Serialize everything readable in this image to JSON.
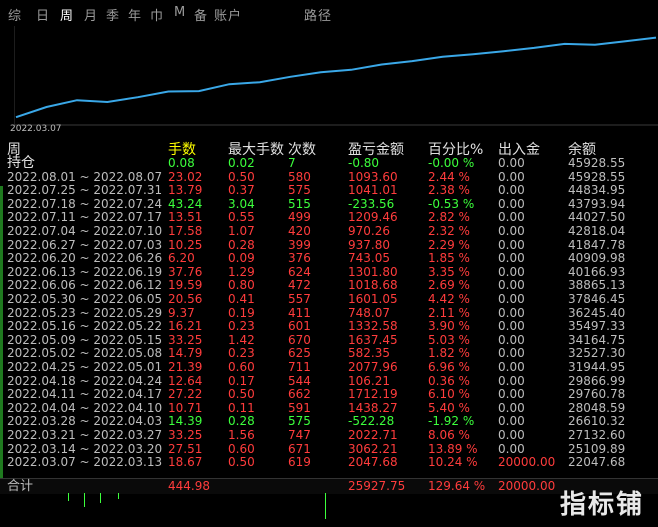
{
  "tabs": [
    {
      "label": "综",
      "active": false
    },
    {
      "label": "日",
      "active": false
    },
    {
      "label": "周",
      "active": true
    },
    {
      "label": "月",
      "active": false
    },
    {
      "label": "季",
      "active": false
    },
    {
      "label": "年",
      "active": false
    },
    {
      "label": "巾",
      "active": false
    },
    {
      "label": "M",
      "active": false
    },
    {
      "label": "备",
      "active": false
    },
    {
      "label": "账户",
      "active": false
    },
    {
      "label": "路径",
      "active": false
    }
  ],
  "chart": {
    "start_date": "2022.03.07",
    "line_color": "#3aa8e8",
    "balances": [
      22047.68,
      25109.89,
      27132.6,
      26610.32,
      28048.59,
      29760.78,
      29866.99,
      31944.95,
      32527.3,
      34164.75,
      35497.33,
      36245.4,
      37846.45,
      38865.13,
      40166.93,
      40909.98,
      41847.78,
      42818.04,
      44027.5,
      43793.94,
      44834.95,
      45928.55
    ]
  },
  "columns": {
    "week": "周",
    "hands": "手数",
    "max": "最大手数",
    "count": "次数",
    "pnl": "盈亏金额",
    "pct": "百分比%",
    "flow": "出入金",
    "balance": "余额"
  },
  "position_row": {
    "label": "持仓",
    "hands": "0.08",
    "max": "0.02",
    "count": "7",
    "pnl": "-0.80",
    "pct": "-0.00 %",
    "flow": "0.00",
    "balance": "45928.55",
    "sign": "green"
  },
  "rows": [
    {
      "week": "2022.08.01 ~ 2022.08.07",
      "hands": "23.02",
      "max": "0.50",
      "count": "580",
      "pnl": "1093.60",
      "pct": "2.44 %",
      "flow": "0.00",
      "balance": "45928.55",
      "sign": "red"
    },
    {
      "week": "2022.07.25 ~ 2022.07.31",
      "hands": "13.79",
      "max": "0.37",
      "count": "575",
      "pnl": "1041.01",
      "pct": "2.38 %",
      "flow": "0.00",
      "balance": "44834.95",
      "sign": "red"
    },
    {
      "week": "2022.07.18 ~ 2022.07.24",
      "hands": "43.24",
      "max": "3.04",
      "count": "515",
      "pnl": "-233.56",
      "pct": "-0.53 %",
      "flow": "0.00",
      "balance": "43793.94",
      "sign": "green"
    },
    {
      "week": "2022.07.11 ~ 2022.07.17",
      "hands": "13.51",
      "max": "0.55",
      "count": "499",
      "pnl": "1209.46",
      "pct": "2.82 %",
      "flow": "0.00",
      "balance": "44027.50",
      "sign": "red"
    },
    {
      "week": "2022.07.04 ~ 2022.07.10",
      "hands": "17.58",
      "max": "1.07",
      "count": "420",
      "pnl": "970.26",
      "pct": "2.32 %",
      "flow": "0.00",
      "balance": "42818.04",
      "sign": "red"
    },
    {
      "week": "2022.06.27 ~ 2022.07.03",
      "hands": "10.25",
      "max": "0.28",
      "count": "399",
      "pnl": "937.80",
      "pct": "2.29 %",
      "flow": "0.00",
      "balance": "41847.78",
      "sign": "red"
    },
    {
      "week": "2022.06.20 ~ 2022.06.26",
      "hands": "6.20",
      "max": "0.09",
      "count": "376",
      "pnl": "743.05",
      "pct": "1.85 %",
      "flow": "0.00",
      "balance": "40909.98",
      "sign": "red"
    },
    {
      "week": "2022.06.13 ~ 2022.06.19",
      "hands": "37.76",
      "max": "1.29",
      "count": "624",
      "pnl": "1301.80",
      "pct": "3.35 %",
      "flow": "0.00",
      "balance": "40166.93",
      "sign": "red"
    },
    {
      "week": "2022.06.06 ~ 2022.06.12",
      "hands": "19.59",
      "max": "0.80",
      "count": "472",
      "pnl": "1018.68",
      "pct": "2.69 %",
      "flow": "0.00",
      "balance": "38865.13",
      "sign": "red"
    },
    {
      "week": "2022.05.30 ~ 2022.06.05",
      "hands": "20.56",
      "max": "0.41",
      "count": "557",
      "pnl": "1601.05",
      "pct": "4.42 %",
      "flow": "0.00",
      "balance": "37846.45",
      "sign": "red"
    },
    {
      "week": "2022.05.23 ~ 2022.05.29",
      "hands": "9.37",
      "max": "0.19",
      "count": "411",
      "pnl": "748.07",
      "pct": "2.11 %",
      "flow": "0.00",
      "balance": "36245.40",
      "sign": "red"
    },
    {
      "week": "2022.05.16 ~ 2022.05.22",
      "hands": "16.21",
      "max": "0.23",
      "count": "601",
      "pnl": "1332.58",
      "pct": "3.90 %",
      "flow": "0.00",
      "balance": "35497.33",
      "sign": "red"
    },
    {
      "week": "2022.05.09 ~ 2022.05.15",
      "hands": "33.25",
      "max": "1.42",
      "count": "670",
      "pnl": "1637.45",
      "pct": "5.03 %",
      "flow": "0.00",
      "balance": "34164.75",
      "sign": "red"
    },
    {
      "week": "2022.05.02 ~ 2022.05.08",
      "hands": "14.79",
      "max": "0.23",
      "count": "625",
      "pnl": "582.35",
      "pct": "1.82 %",
      "flow": "0.00",
      "balance": "32527.30",
      "sign": "red"
    },
    {
      "week": "2022.04.25 ~ 2022.05.01",
      "hands": "21.39",
      "max": "0.60",
      "count": "711",
      "pnl": "2077.96",
      "pct": "6.96 %",
      "flow": "0.00",
      "balance": "31944.95",
      "sign": "red"
    },
    {
      "week": "2022.04.18 ~ 2022.04.24",
      "hands": "12.64",
      "max": "0.17",
      "count": "544",
      "pnl": "106.21",
      "pct": "0.36 %",
      "flow": "0.00",
      "balance": "29866.99",
      "sign": "red"
    },
    {
      "week": "2022.04.11 ~ 2022.04.17",
      "hands": "27.22",
      "max": "0.50",
      "count": "662",
      "pnl": "1712.19",
      "pct": "6.10 %",
      "flow": "0.00",
      "balance": "29760.78",
      "sign": "red"
    },
    {
      "week": "2022.04.04 ~ 2022.04.10",
      "hands": "10.71",
      "max": "0.11",
      "count": "591",
      "pnl": "1438.27",
      "pct": "5.40 %",
      "flow": "0.00",
      "balance": "28048.59",
      "sign": "red"
    },
    {
      "week": "2022.03.28 ~ 2022.04.03",
      "hands": "14.39",
      "max": "0.28",
      "count": "575",
      "pnl": "-522.28",
      "pct": "-1.92 %",
      "flow": "0.00",
      "balance": "26610.32",
      "sign": "green"
    },
    {
      "week": "2022.03.21 ~ 2022.03.27",
      "hands": "33.25",
      "max": "1.56",
      "count": "747",
      "pnl": "2022.71",
      "pct": "8.06 %",
      "flow": "0.00",
      "balance": "27132.60",
      "sign": "red"
    },
    {
      "week": "2022.03.14 ~ 2022.03.20",
      "hands": "27.51",
      "max": "0.60",
      "count": "671",
      "pnl": "3062.21",
      "pct": "13.89 %",
      "flow": "0.00",
      "balance": "25109.89",
      "sign": "red"
    },
    {
      "week": "2022.03.07 ~ 2022.03.13",
      "hands": "18.67",
      "max": "0.50",
      "count": "619",
      "pnl": "2047.68",
      "pct": "10.24 %",
      "flow": "20000.00",
      "balance": "22047.68",
      "sign": "red"
    }
  ],
  "total_row": {
    "label": "合计",
    "hands": "444.98",
    "pnl": "25927.75",
    "pct": "129.64 %",
    "flow": "20000.00"
  },
  "watermark": "指标铺",
  "colors": {
    "profit": "#ff3c3c",
    "loss": "#3cff3c",
    "accent": "#3aa8e8",
    "hands_header": "#ffff00"
  }
}
